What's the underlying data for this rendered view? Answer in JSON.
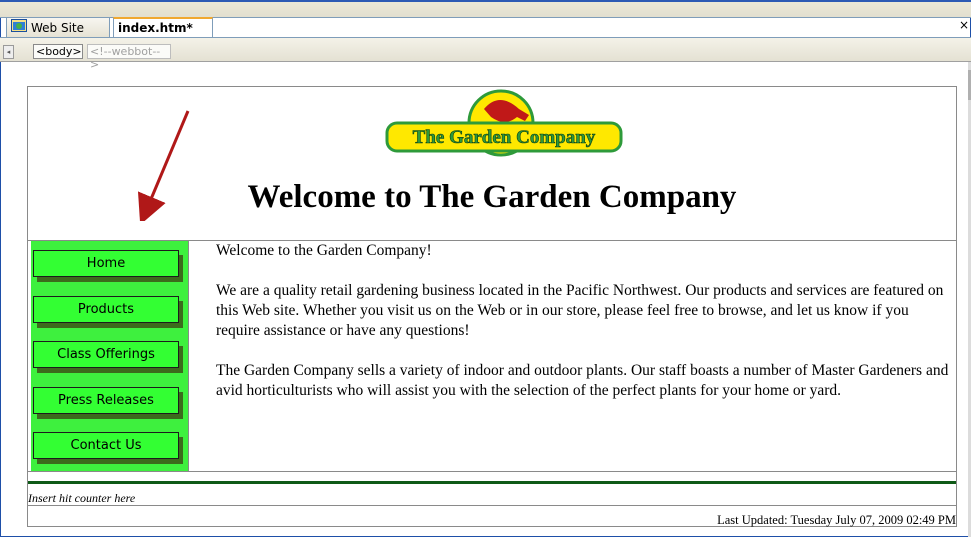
{
  "tabs": [
    {
      "label": "Web Site",
      "icon": "website-icon"
    },
    {
      "label": "index.htm*"
    }
  ],
  "tab_close": "×",
  "tag_selector": {
    "scroll_left": "◂",
    "tags": [
      "<body>",
      "<!--webbot-->"
    ]
  },
  "page": {
    "logo_text": "The Garden Company",
    "title": "Welcome to The Garden Company",
    "nav_items": [
      "Home",
      "Products",
      "Class Offerings",
      "Press Releases",
      "Contact Us"
    ],
    "paragraphs": [
      "Welcome to the Garden Company!",
      "We are a quality retail gardening business located in the Pacific Northwest. Our products and services are featured on this Web site. Whether you visit us on the Web or in our store, please feel free to browse, and let us know if you require assistance or have any questions!",
      "The Garden Company sells a variety of indoor and outdoor plants. Our staff boasts a number of Master Gardeners and avid horticulturists who will assist you with the selection of the perfect plants for your home or yard."
    ],
    "hit_counter": "Insert hit counter here",
    "last_updated": "Last Updated: Tuesday July 07, 2009 02:49 PM"
  },
  "colors": {
    "nav_background": "#3ef03e",
    "nav_button": "#33ff33",
    "rule": "#0f5a17",
    "arrow": "#b01818",
    "logo_yellow": "#ffe800",
    "logo_green": "#2e9a3a"
  }
}
